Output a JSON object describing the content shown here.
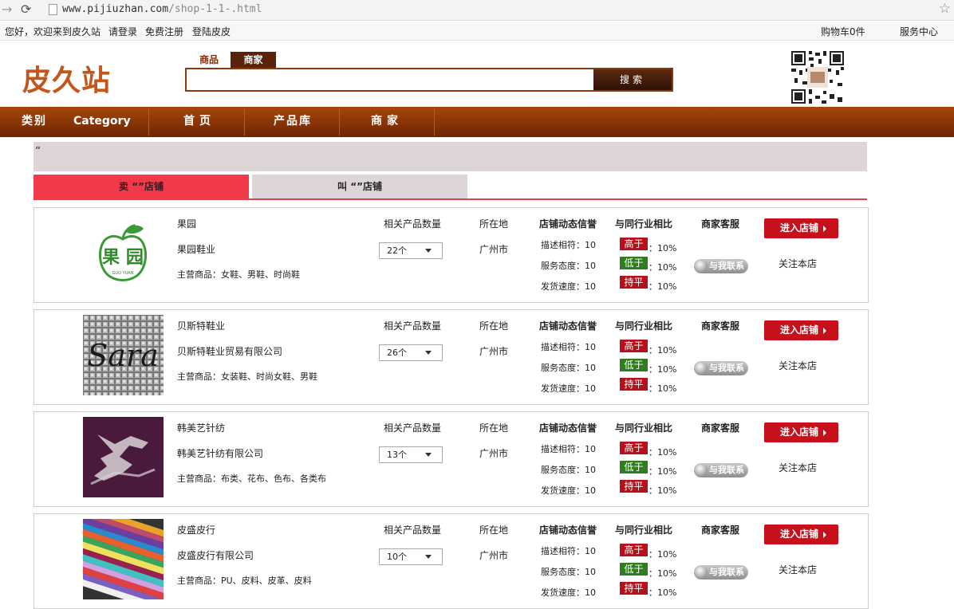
{
  "browser": {
    "url_host": "www.pijiuzhan.com",
    "url_path": "/shop-1-1-.html"
  },
  "topbar": {
    "welcome": "您好，欢迎来到皮久站",
    "login": "请登录",
    "register": "免费注册",
    "login_leather": "登陆皮皮",
    "cart": "购物车0件",
    "service": "服务中心"
  },
  "header": {
    "logo": "皮久站",
    "search_tabs": [
      "商品",
      "商家"
    ],
    "search_value": "",
    "search_button": "搜索"
  },
  "nav": {
    "items": [
      "类别",
      "Category",
      "首页",
      "产品库",
      "商家"
    ]
  },
  "breadcrumb": "“",
  "tabs": [
    "卖 “”店铺",
    "叫 “”店铺"
  ],
  "columns": {
    "product_count": "相关产品数量",
    "location": "所在地",
    "rating": "店铺动态信誉",
    "compare": "与同行业相比",
    "service": "商家客服"
  },
  "rating_labels": {
    "describe": "描述相符：10",
    "attitude": "服务态度：10",
    "delivery": "发货速度：10"
  },
  "compare_badges": [
    {
      "label": "高于",
      "color": "#b5101c",
      "pct": "：10%"
    },
    {
      "label": "低于",
      "color": "#2e7d1e",
      "pct": "：10%"
    },
    {
      "label": "持平",
      "color": "#b5101c",
      "pct": "：10%"
    }
  ],
  "actions": {
    "contact": "与我联系",
    "enter": "进入店铺",
    "follow": "关注本店"
  },
  "shops": [
    {
      "name": "果园",
      "company": "果园鞋业",
      "main": "主营商品：女鞋、男鞋、时尚鞋",
      "count": "22个",
      "city": "广州市",
      "thumb": "apple-logo"
    },
    {
      "name": "贝斯特鞋业",
      "company": "贝斯特鞋业贸易有限公司",
      "main": "主营商品：女装鞋、时尚女鞋、男鞋",
      "count": "26个",
      "city": "广州市",
      "thumb": "sara-photo"
    },
    {
      "name": "韩美艺针纺",
      "company": "韩美艺针纺有限公司",
      "main": "主营商品：布类、花布、色布、各类布",
      "count": "13个",
      "city": "广州市",
      "thumb": "purple-fabric"
    },
    {
      "name": "皮盛皮行",
      "company": "皮盛皮行有限公司",
      "main": "主营商品：PU、皮料、皮革、皮料",
      "count": "10个",
      "city": "广州市",
      "thumb": "leather-swatches"
    }
  ]
}
